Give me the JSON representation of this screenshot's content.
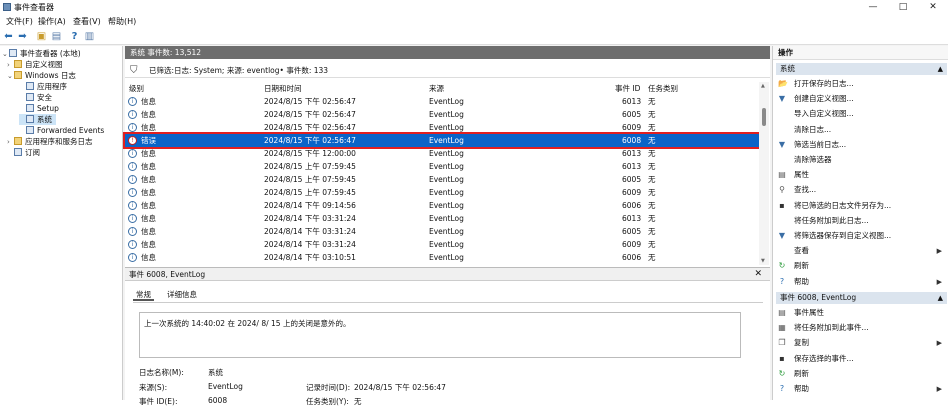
{
  "window": {
    "title": "事件查看器",
    "min": "—",
    "max": "□",
    "close": "✕"
  },
  "menu": [
    "文件(F)",
    "操作(A)",
    "查看(V)",
    "帮助(H)"
  ],
  "tree": [
    {
      "label": "事件查看器 (本地)",
      "arrow": "⌄",
      "icon": "event-viewer-icon"
    },
    {
      "label": "自定义视图",
      "arrow": "›",
      "icon": "folder-icon"
    },
    {
      "label": "Windows 日志",
      "arrow": "⌄",
      "icon": "folder-icon"
    },
    {
      "label": "应用程序",
      "arrow": "",
      "icon": "log-icon"
    },
    {
      "label": "安全",
      "arrow": "",
      "icon": "log-icon"
    },
    {
      "label": "Setup",
      "arrow": "",
      "icon": "log-icon"
    },
    {
      "label": "系统",
      "arrow": "",
      "icon": "log-icon"
    },
    {
      "label": "Forwarded Events",
      "arrow": "",
      "icon": "log-icon"
    },
    {
      "label": "应用程序和服务日志",
      "arrow": "›",
      "icon": "folder-icon"
    },
    {
      "label": "订阅",
      "arrow": "",
      "icon": "subscription-icon"
    }
  ],
  "center": {
    "header": "系统    事件数: 13,512",
    "filter": "已筛选:日志: System; 来源: eventlog• 事件数: 133",
    "columns": {
      "level": "级别",
      "datetime": "日期和时间",
      "source": "来源",
      "eventid": "事件 ID",
      "category": "任务类别"
    },
    "rows": [
      {
        "level": "信息",
        "datetime": "2024/8/15 下午 02:56:47",
        "source": "EventLog",
        "eventid": "6013",
        "category": "无"
      },
      {
        "level": "信息",
        "datetime": "2024/8/15 下午 02:56:47",
        "source": "EventLog",
        "eventid": "6005",
        "category": "无"
      },
      {
        "level": "信息",
        "datetime": "2024/8/15 下午 02:56:47",
        "source": "EventLog",
        "eventid": "6009",
        "category": "无"
      },
      {
        "level": "错误",
        "datetime": "2024/8/15 下午 02:56:47",
        "source": "EventLog",
        "eventid": "6008",
        "category": "无"
      },
      {
        "level": "信息",
        "datetime": "2024/8/15 下午 12:00:00",
        "source": "EventLog",
        "eventid": "6013",
        "category": "无"
      },
      {
        "level": "信息",
        "datetime": "2024/8/15 上午 07:59:45",
        "source": "EventLog",
        "eventid": "6013",
        "category": "无"
      },
      {
        "level": "信息",
        "datetime": "2024/8/15 上午 07:59:45",
        "source": "EventLog",
        "eventid": "6005",
        "category": "无"
      },
      {
        "level": "信息",
        "datetime": "2024/8/15 上午 07:59:45",
        "source": "EventLog",
        "eventid": "6009",
        "category": "无"
      },
      {
        "level": "信息",
        "datetime": "2024/8/14 下午 09:14:56",
        "source": "EventLog",
        "eventid": "6006",
        "category": "无"
      },
      {
        "level": "信息",
        "datetime": "2024/8/14 下午 03:31:24",
        "source": "EventLog",
        "eventid": "6013",
        "category": "无"
      },
      {
        "level": "信息",
        "datetime": "2024/8/14 下午 03:31:24",
        "source": "EventLog",
        "eventid": "6005",
        "category": "无"
      },
      {
        "level": "信息",
        "datetime": "2024/8/14 下午 03:31:24",
        "source": "EventLog",
        "eventid": "6009",
        "category": "无"
      },
      {
        "level": "信息",
        "datetime": "2024/8/14 下午 03:10:51",
        "source": "EventLog",
        "eventid": "6006",
        "category": "无"
      }
    ],
    "selected_row": 3
  },
  "detail": {
    "header": "事件 6008, EventLog",
    "tabs": [
      "常规",
      "详细信息"
    ],
    "message": "上一次系统的 14:40:02 在    2024/   8/   15 上的关闭是意外的。",
    "log_name_label": "日志名称(M):",
    "log_name_value": "系统",
    "source_label": "来源(S):",
    "source_value": "EventLog",
    "logged_label": "记录时间(D):",
    "logged_value": "2024/8/15 下午 02:56:47",
    "eventid_label": "事件 ID(E):",
    "eventid_value": "6008",
    "category_label": "任务类别(Y):",
    "category_value": "无"
  },
  "actions": {
    "header": "操作",
    "section1": "系统",
    "items1": [
      {
        "label": "打开保存的日志...",
        "icon": "open-log-icon",
        "sub": ""
      },
      {
        "label": "创建自定义视图...",
        "icon": "filter-icon",
        "sub": ""
      },
      {
        "label": "导入自定义视图...",
        "icon": "",
        "sub": ""
      },
      {
        "label": "清除日志...",
        "icon": "",
        "sub": ""
      },
      {
        "label": "筛选当前日志...",
        "icon": "filter-icon",
        "sub": ""
      },
      {
        "label": "清除筛选器",
        "icon": "",
        "sub": ""
      },
      {
        "label": "属性",
        "icon": "properties-icon",
        "sub": ""
      },
      {
        "label": "查找...",
        "icon": "find-icon",
        "sub": ""
      },
      {
        "label": "将已筛选的日志文件另存为...",
        "icon": "save-icon",
        "sub": ""
      },
      {
        "label": "将任务附加到此日志...",
        "icon": "",
        "sub": ""
      },
      {
        "label": "将筛选器保存到自定义视图...",
        "icon": "filter-save-icon",
        "sub": ""
      },
      {
        "label": "查看",
        "icon": "",
        "sub": "▶"
      },
      {
        "label": "刷新",
        "icon": "refresh-icon",
        "sub": ""
      },
      {
        "label": "帮助",
        "icon": "help-icon",
        "sub": "▶"
      }
    ],
    "section2": "事件 6008, EventLog",
    "items2": [
      {
        "label": "事件属性",
        "icon": "event-properties-icon",
        "sub": ""
      },
      {
        "label": "将任务附加到此事件...",
        "icon": "task-icon",
        "sub": ""
      },
      {
        "label": "复制",
        "icon": "copy-icon",
        "sub": "▶"
      },
      {
        "label": "保存选择的事件...",
        "icon": "save-icon",
        "sub": ""
      },
      {
        "label": "刷新",
        "icon": "refresh-icon",
        "sub": ""
      },
      {
        "label": "帮助",
        "icon": "help-icon",
        "sub": "▶"
      }
    ]
  }
}
